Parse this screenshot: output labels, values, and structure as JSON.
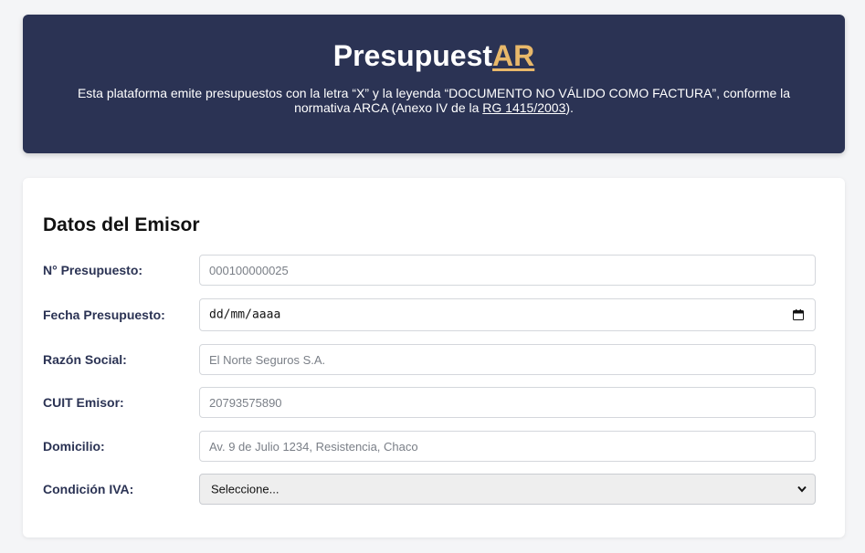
{
  "header": {
    "brand_main": "Presupuest",
    "brand_accent": "AR",
    "notice_text": "Esta plataforma emite presupuestos con la letra “X” y la leyenda “DOCUMENTO NO VÁLIDO COMO FACTURA”, conforme la normativa ARCA (Anexo IV de la ",
    "notice_link": "RG 1415/2003",
    "notice_end": ")."
  },
  "form": {
    "title": "Datos del Emisor",
    "fields": [
      {
        "label": "N° Presupuesto:",
        "placeholder": "000100000025"
      },
      {
        "label": "Fecha Presupuesto:",
        "value": "dd/mm/aaaa"
      },
      {
        "label": "Razón Social:",
        "placeholder": "El Norte Seguros S.A."
      },
      {
        "label": "CUIT Emisor:",
        "placeholder": "20793575890"
      },
      {
        "label": "Domicilio:",
        "placeholder": "Av. 9 de Julio 1234, Resistencia, Chaco"
      },
      {
        "label": "Condición IVA:",
        "selected": "Seleccione..."
      }
    ]
  },
  "colors": {
    "header_bg": "#2b3354",
    "brand_accent": "#e8b86a",
    "label_text": "#2b3354"
  },
  "icons": {
    "date_picker": "calendar-icon",
    "select_arrow": "chevron-down-icon"
  }
}
